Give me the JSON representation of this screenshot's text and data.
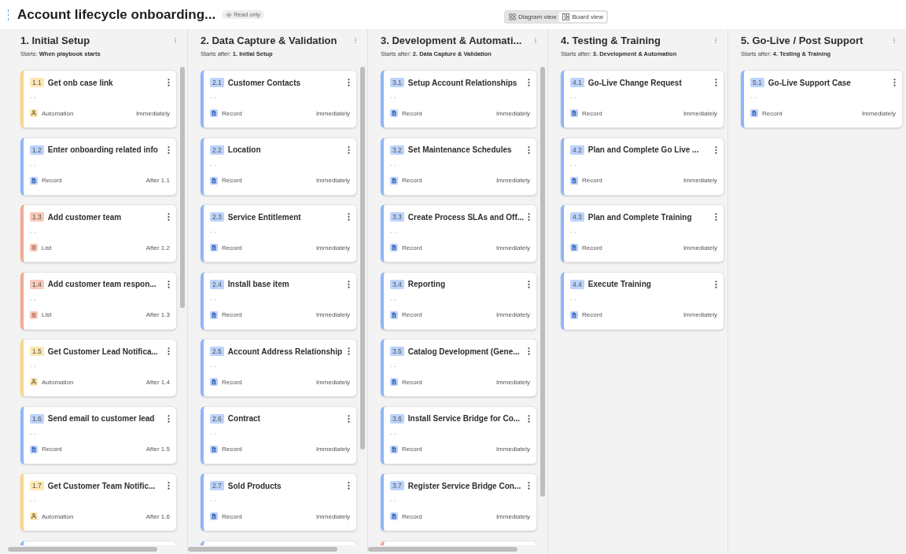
{
  "header": {
    "title": "Account lifecycle onboarding...",
    "badge": "Read only",
    "views": [
      {
        "label": "Diagram view",
        "kind": "diagram",
        "selected": false
      },
      {
        "label": "Board view",
        "kind": "board",
        "selected": true
      }
    ]
  },
  "columns": [
    {
      "title": "1. Initial Setup",
      "starts_label": "Starts:",
      "starts_value": "When playbook starts",
      "scrollable": true,
      "cards": [
        {
          "number": "1.1",
          "title": "Get onb case link",
          "description": "- -",
          "kind": "automation",
          "type_label": "Automation",
          "timing": "Immediately"
        },
        {
          "number": "1.2",
          "title": "Enter onboarding related info",
          "description": "- -",
          "kind": "record",
          "type_label": "Record",
          "timing": "After 1.1"
        },
        {
          "number": "1.3",
          "title": "Add customer team",
          "description": "- -",
          "kind": "list",
          "type_label": "List",
          "timing": "After 1.2"
        },
        {
          "number": "1.4",
          "title": "Add customer team respon...",
          "description": "- -",
          "kind": "list",
          "type_label": "List",
          "timing": "After 1.3"
        },
        {
          "number": "1.5",
          "title": "Get Customer Lead Notifica...",
          "description": "- -",
          "kind": "automation",
          "type_label": "Automation",
          "timing": "After 1.4"
        },
        {
          "number": "1.6",
          "title": "Send email to customer lead",
          "description": "- -",
          "kind": "record",
          "type_label": "Record",
          "timing": "After 1.5"
        },
        {
          "number": "1.7",
          "title": "Get Customer Team Notific...",
          "description": "- -",
          "kind": "automation",
          "type_label": "Automation",
          "timing": "After 1.6"
        },
        {
          "kind": "record"
        }
      ]
    },
    {
      "title": "2. Data Capture & Validation",
      "starts_label": "Starts after:",
      "starts_value": "1. Initial Setup",
      "scrollable": true,
      "cards": [
        {
          "number": "2.1",
          "title": "Customer Contacts",
          "description": "- -",
          "kind": "record",
          "type_label": "Record",
          "timing": "Immediately"
        },
        {
          "number": "2.2",
          "title": "Location",
          "description": "- -",
          "kind": "record",
          "type_label": "Record",
          "timing": "Immediately"
        },
        {
          "number": "2.3",
          "title": "Service Entitlement",
          "description": "- -",
          "kind": "record",
          "type_label": "Record",
          "timing": "Immediately"
        },
        {
          "number": "2.4",
          "title": "Install base item",
          "description": "- -",
          "kind": "record",
          "type_label": "Record",
          "timing": "Immediately"
        },
        {
          "number": "2.5",
          "title": "Account Address Relationship",
          "description": "- -",
          "kind": "record",
          "type_label": "Record",
          "timing": "Immediately"
        },
        {
          "number": "2.6",
          "title": "Contract",
          "description": "- -",
          "kind": "record",
          "type_label": "Record",
          "timing": "Immediately"
        },
        {
          "number": "2.7",
          "title": "Sold Products",
          "description": "- -",
          "kind": "record",
          "type_label": "Record",
          "timing": "Immediately"
        },
        {
          "kind": "record"
        }
      ]
    },
    {
      "title": "3. Development & Automati...",
      "starts_label": "Starts after:",
      "starts_value": "2. Data Capture & Validation",
      "scrollable": true,
      "cards": [
        {
          "number": "3.1",
          "title": "Setup Account Relationships",
          "description": "- -",
          "kind": "record",
          "type_label": "Record",
          "timing": "Immediately"
        },
        {
          "number": "3.2",
          "title": "Set Maintenance Schedules",
          "description": "- -",
          "kind": "record",
          "type_label": "Record",
          "timing": "Immediately"
        },
        {
          "number": "3.3",
          "title": "Create Process SLAs and Off...",
          "description": "- -",
          "kind": "record",
          "type_label": "Record",
          "timing": "Immediately"
        },
        {
          "number": "3.4",
          "title": "Reporting",
          "description": "- -",
          "kind": "record",
          "type_label": "Record",
          "timing": "Immediately"
        },
        {
          "number": "3.5",
          "title": "Catalog Development (Gene...",
          "description": "- -",
          "kind": "record",
          "type_label": "Record",
          "timing": "Immediately"
        },
        {
          "number": "3.6",
          "title": "Install Service Bridge for Co...",
          "description": "- -",
          "kind": "record",
          "type_label": "Record",
          "timing": "Immediately"
        },
        {
          "number": "3.7",
          "title": "Register Service Bridge Con...",
          "description": "- -",
          "kind": "record",
          "type_label": "Record",
          "timing": "Immediately"
        },
        {
          "kind": "list"
        }
      ]
    },
    {
      "title": "4. Testing & Training",
      "starts_label": "Starts after:",
      "starts_value": "3. Development & Automation",
      "cards": [
        {
          "number": "4.1",
          "title": "Go-Live Change Request",
          "description": "- -",
          "kind": "record",
          "type_label": "Record",
          "timing": "Immediately"
        },
        {
          "number": "4.2",
          "title": "Plan and Complete Go Live ...",
          "description": "- -",
          "kind": "record",
          "type_label": "Record",
          "timing": "Immediately"
        },
        {
          "number": "4.3",
          "title": "Plan and Complete Training",
          "description": "- -",
          "kind": "record",
          "type_label": "Record",
          "timing": "Immediately"
        },
        {
          "number": "4.4",
          "title": "Execute Training",
          "description": "- -",
          "kind": "record",
          "type_label": "Record",
          "timing": "Immediately"
        }
      ]
    },
    {
      "title": "5. Go-Live / Post Support",
      "starts_label": "Starts after:",
      "starts_value": "4. Testing & Training",
      "cards": [
        {
          "number": "5.1",
          "title": "Go-Live Support Case",
          "description": "- -",
          "kind": "record",
          "type_label": "Record",
          "timing": "Immediately"
        }
      ]
    }
  ]
}
